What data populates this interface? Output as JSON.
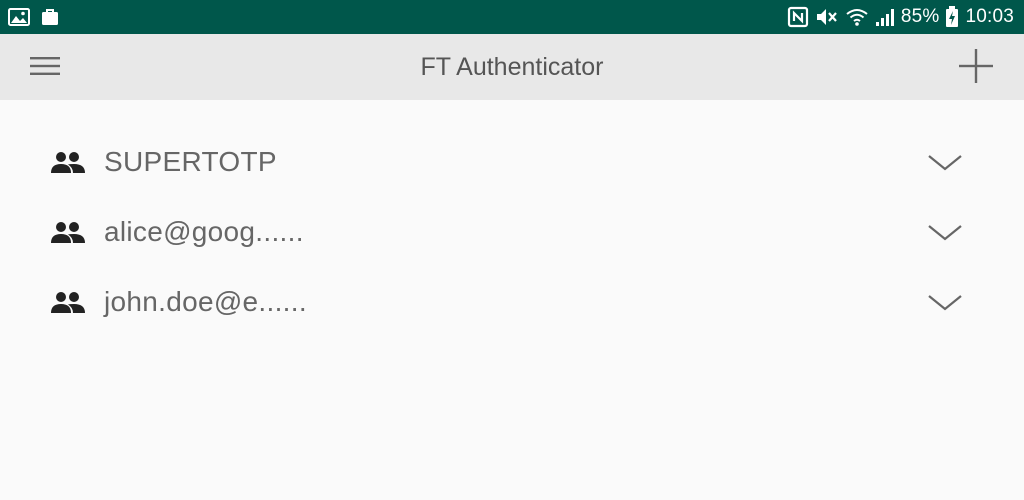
{
  "status_bar": {
    "left_icons": [
      "image-icon",
      "briefcase-icon"
    ],
    "right_icons": [
      "nfc-icon",
      "mute-icon",
      "wifi-icon",
      "signal-icon"
    ],
    "battery_percent": "85%",
    "time": "10:03",
    "background_color": "#00574b"
  },
  "toolbar": {
    "title": "FT Authenticator",
    "menu_icon": "hamburger-menu-icon",
    "add_icon": "plus-icon",
    "background_color": "#e8e8e8"
  },
  "accounts": [
    {
      "label": "SUPERTOTP",
      "icon": "people-icon",
      "expand_icon": "chevron-down-icon"
    },
    {
      "label": "alice@goog......",
      "icon": "people-icon",
      "expand_icon": "chevron-down-icon"
    },
    {
      "label": "john.doe@e......",
      "icon": "people-icon",
      "expand_icon": "chevron-down-icon"
    }
  ]
}
